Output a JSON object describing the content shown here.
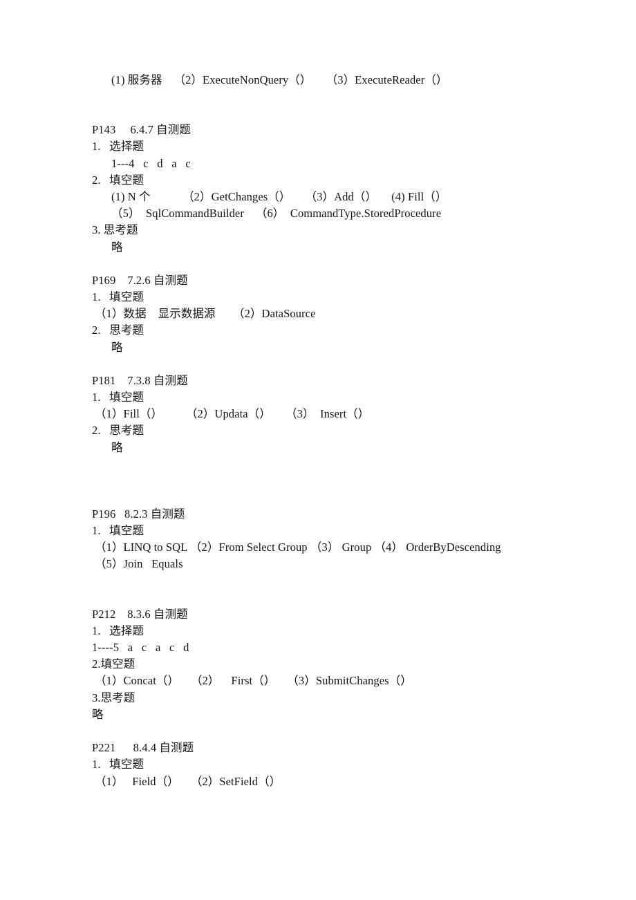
{
  "document": {
    "title": "自测题答案",
    "page_background": "#ffffff",
    "text_color": "#141414"
  },
  "blocks": [
    {
      "id": "intro-answers",
      "lines": [
        {
          "id": "intro-line-1",
          "indent": 2,
          "text": "(1) 服务器    （2）ExecuteNonQuery（）     （3）ExecuteReader（）"
        }
      ]
    },
    {
      "id": "p143",
      "heading": "P143     6.4.7 自测题",
      "lines": [
        {
          "id": "p143-1",
          "indent": 0,
          "text": "1.   选择题"
        },
        {
          "id": "p143-2",
          "indent": 2,
          "text": "1---4   c   d   a   c"
        },
        {
          "id": "p143-3",
          "indent": 0,
          "text": "2.   填空题"
        },
        {
          "id": "p143-4",
          "indent": 2,
          "text": "(1) N 个           （2）GetChanges（）     （3）Add（）     (4) Fill（）"
        },
        {
          "id": "p143-5",
          "indent": 2,
          "text": "（5）  SqlCommandBuilder    （6）  CommandType.StoredProcedure"
        },
        {
          "id": "p143-6",
          "indent": 0,
          "text": "3. 思考题"
        },
        {
          "id": "p143-7",
          "indent": 2,
          "text": "略"
        }
      ]
    },
    {
      "id": "p169",
      "heading": "P169    7.2.6 自测题",
      "lines": [
        {
          "id": "p169-1",
          "indent": 0,
          "text": "1.   填空题"
        },
        {
          "id": "p169-2",
          "indent": 1,
          "text": "（1）数据    显示数据源      （2）DataSource"
        },
        {
          "id": "p169-3",
          "indent": 0,
          "text": "2.   思考题"
        },
        {
          "id": "p169-4",
          "indent": 2,
          "text": "略"
        }
      ]
    },
    {
      "id": "p181",
      "heading": "P181    7.3.8 自测题",
      "lines": [
        {
          "id": "p181-1",
          "indent": 0,
          "text": "1.   填空题"
        },
        {
          "id": "p181-2",
          "indent": 1,
          "text": "（1）Fill（）        （2）Updata（）     （3）  Insert（）"
        },
        {
          "id": "p181-3",
          "indent": 0,
          "text": "2.   思考题"
        },
        {
          "id": "p181-4",
          "indent": 2,
          "text": "略"
        }
      ]
    },
    {
      "id": "p196",
      "heading": "P196   8.2.3 自测题",
      "lines": [
        {
          "id": "p196-1",
          "indent": 0,
          "text": "1.   填空题"
        },
        {
          "id": "p196-2",
          "indent": 1,
          "wrap": true,
          "text": "（1）LINQ to SQL （2）From Select Group （3） Group （4） OrderByDescending"
        },
        {
          "id": "p196-3",
          "indent": 1,
          "text": "（5）Join   Equals"
        }
      ]
    },
    {
      "id": "p212",
      "heading": "P212    8.3.6 自测题",
      "lines": [
        {
          "id": "p212-1",
          "indent": 0,
          "text": "1.   选择题"
        },
        {
          "id": "p212-2",
          "indent": 0,
          "text": "1----5   a   c   a   c   d"
        },
        {
          "id": "p212-3",
          "indent": 0,
          "text": "2.填空题"
        },
        {
          "id": "p212-4",
          "indent": 1,
          "text": "（1）Concat（）    （2）    First（）    （3）SubmitChanges（）"
        },
        {
          "id": "p212-5",
          "indent": 0,
          "text": "3.思考题"
        },
        {
          "id": "p212-6",
          "indent": 0,
          "text": "略"
        }
      ]
    },
    {
      "id": "p221",
      "heading": "P221      8.4.4 自测题",
      "lines": [
        {
          "id": "p221-1",
          "indent": 0,
          "text": "1.   填空题"
        },
        {
          "id": "p221-2",
          "indent": 1,
          "text": "（1）   Field（）    （2）SetField（）"
        }
      ]
    }
  ]
}
